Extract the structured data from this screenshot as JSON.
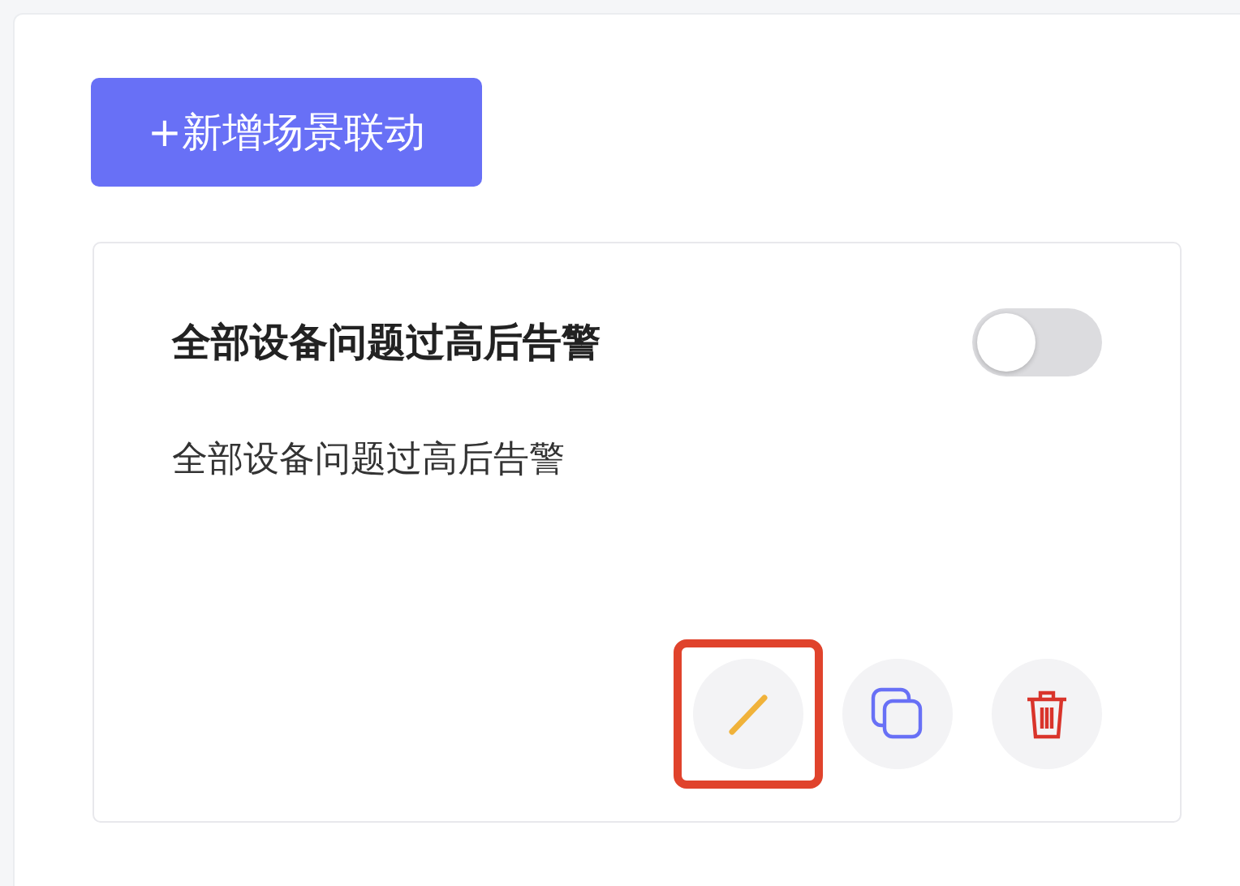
{
  "add_button": {
    "label": "+新增场景联动"
  },
  "cards": [
    {
      "title": "全部设备问题过高后告警",
      "on": false,
      "description": "全部设备问题过高后告警",
      "actions": [
        {
          "kind": "edit",
          "highlighted": true
        },
        {
          "kind": "copy",
          "highlighted": false
        },
        {
          "kind": "delete",
          "highlighted": false
        }
      ]
    }
  ]
}
